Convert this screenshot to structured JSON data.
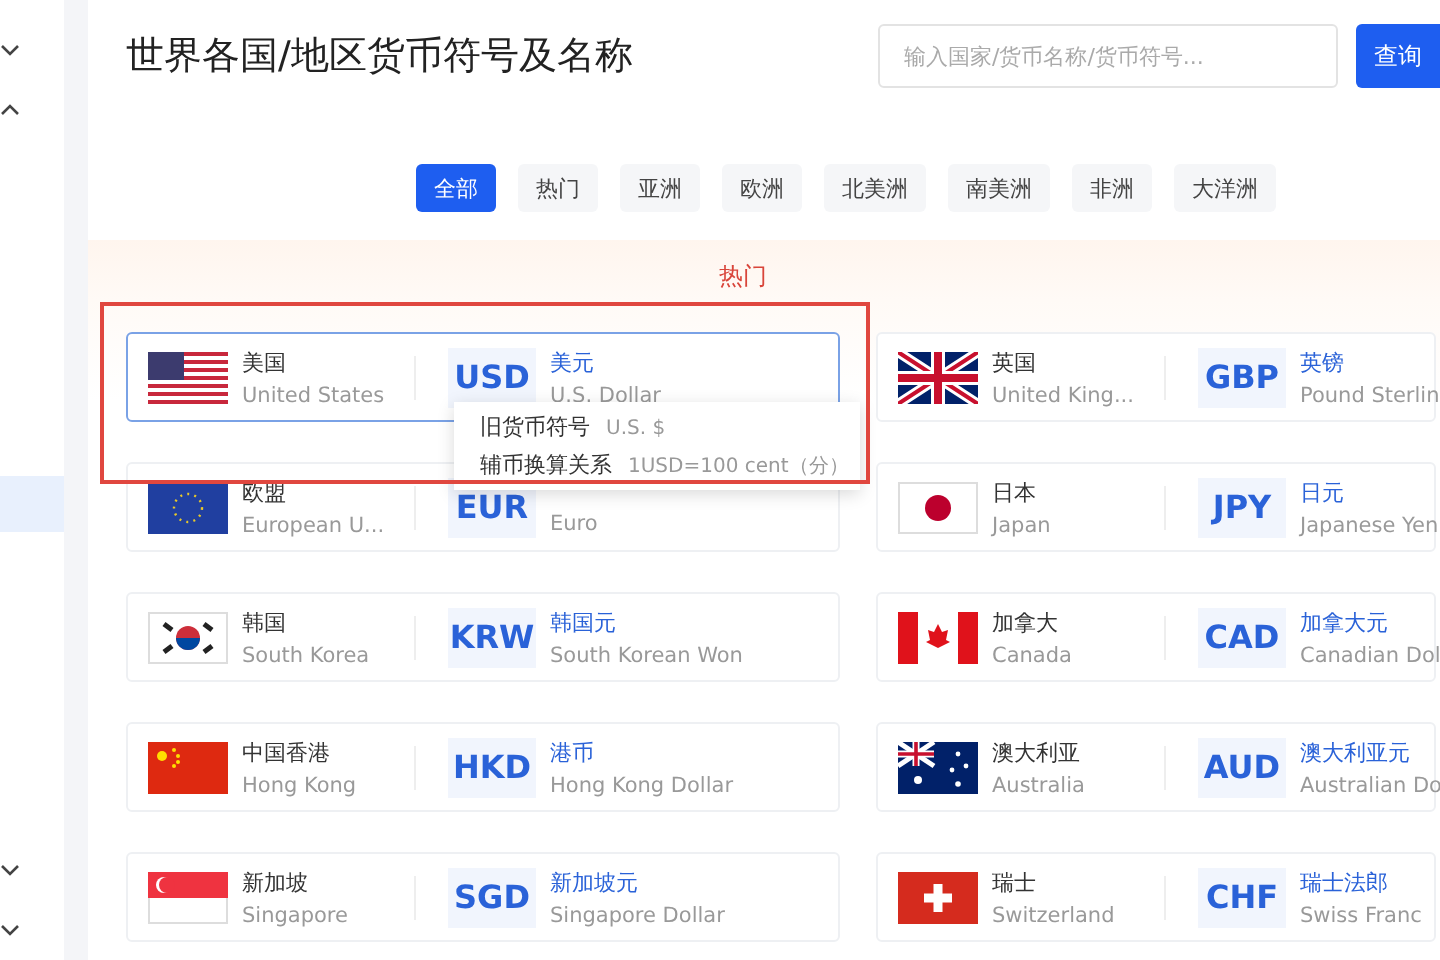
{
  "sidebar": {
    "items": [
      {
        "kind": "toggle",
        "expanded": false
      },
      {
        "kind": "toggle",
        "expanded": true
      },
      {
        "kind": "entry",
        "selected": true
      },
      {
        "kind": "toggle",
        "expanded": false
      },
      {
        "kind": "toggle",
        "expanded": false
      }
    ]
  },
  "page_title": "世界各国/地区货币符号及名称",
  "search": {
    "placeholder": "输入国家/货币名称/货币符号..."
  },
  "search_button": "查询",
  "filters": [
    {
      "label": "全部",
      "selected": true
    },
    {
      "label": "热门",
      "selected": false
    },
    {
      "label": "亚洲",
      "selected": false
    },
    {
      "label": "欧洲",
      "selected": false
    },
    {
      "label": "北美洲",
      "selected": false
    },
    {
      "label": "南美洲",
      "selected": false
    },
    {
      "label": "非洲",
      "selected": false
    },
    {
      "label": "大洋洲",
      "selected": false
    }
  ],
  "section": {
    "title": "热门",
    "highlight_frame": true
  },
  "cards": [
    {
      "country": "美国",
      "country_en": "United States",
      "code": "USD",
      "currency": "美元",
      "currency_en": "U.S. Dollar",
      "hovered": true,
      "tooltip": [
        {
          "label": "旧货币符号",
          "value": "U.S. $"
        },
        {
          "label": "辅币换算关系",
          "value": "1USD=100 cent（分）"
        }
      ]
    },
    {
      "country": "英国",
      "country_en": "United King...",
      "code": "GBP",
      "currency": "英镑",
      "currency_en": "Pound Sterlin",
      "hovered": false
    },
    {
      "country": "欧盟",
      "country_en": "European U...",
      "code": "EUR",
      "currency_en": "Euro",
      "hovered": false
    },
    {
      "country": "日本",
      "country_en": "Japan",
      "code": "JPY",
      "currency": "日元",
      "currency_en": "Japanese Yen",
      "hovered": false
    },
    {
      "country": "韩国",
      "country_en": "South Korea",
      "code": "KRW",
      "currency": "韩国元",
      "currency_en": "South Korean Won",
      "hovered": false
    },
    {
      "country": "加拿大",
      "country_en": "Canada",
      "code": "CAD",
      "currency": "加拿大元",
      "currency_en": "Canadian Dol",
      "hovered": false
    },
    {
      "country": "中国香港",
      "country_en": "Hong Kong",
      "code": "HKD",
      "currency": "港币",
      "currency_en": "Hong Kong Dollar",
      "hovered": false
    },
    {
      "country": "澳大利亚",
      "country_en": "Australia",
      "code": "AUD",
      "currency": "澳大利亚元",
      "currency_en": "Australian Do",
      "hovered": false
    },
    {
      "country": "新加坡",
      "country_en": "Singapore",
      "code": "SGD",
      "currency": "新加坡元",
      "currency_en": "Singapore Dollar",
      "hovered": false
    },
    {
      "country": "瑞士",
      "country_en": "Switzerland",
      "code": "CHF",
      "currency": "瑞士法郎",
      "currency_en": "Swiss Franc",
      "hovered": false
    }
  ]
}
